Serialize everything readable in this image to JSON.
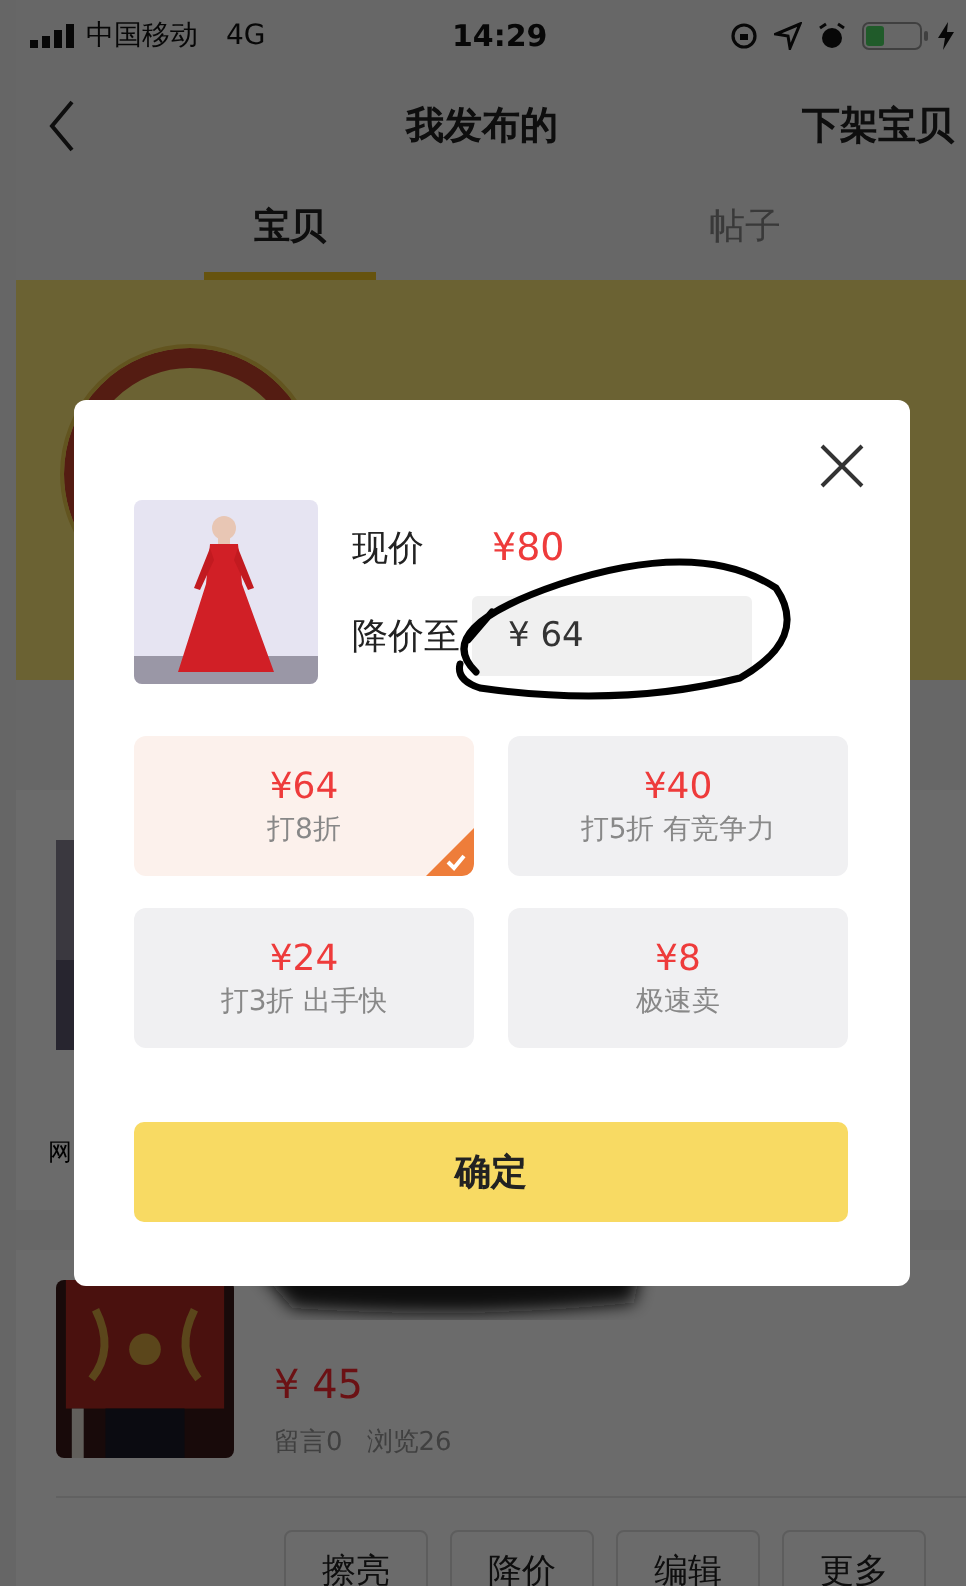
{
  "status_bar": {
    "carrier": "中国移动",
    "network": "4G",
    "time": "14:29"
  },
  "nav": {
    "title": "我发布的",
    "action": "下架宝贝"
  },
  "tabs": [
    {
      "label": "宝贝",
      "selected": true
    },
    {
      "label": "帖子",
      "selected": false
    }
  ],
  "item_1": {
    "text_fragment": "网"
  },
  "item_2": {
    "price": "¥ 45",
    "comments": "留言0",
    "views": "浏览26",
    "actions": [
      "擦亮",
      "降价",
      "编辑",
      "更多"
    ]
  },
  "dialog": {
    "current_label": "现价",
    "current_price": "¥80",
    "reduce_label": "降价至",
    "reduce_value": "¥ 64",
    "options": [
      {
        "price": "¥64",
        "note": "打8折",
        "selected": true
      },
      {
        "price": "¥40",
        "note": "打5折 有竞争力",
        "selected": false
      },
      {
        "price": "¥24",
        "note": "打3折 出手快",
        "selected": false
      },
      {
        "price": "¥8",
        "note": "极速卖",
        "selected": false
      }
    ],
    "confirm": "确定"
  }
}
